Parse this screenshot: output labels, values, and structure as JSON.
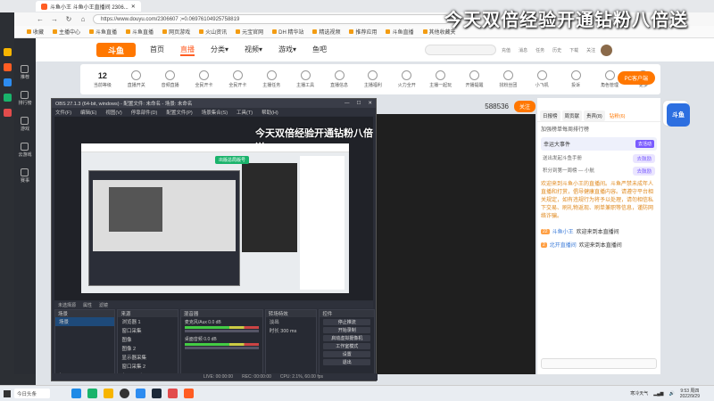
{
  "browser": {
    "tab_title": "斗鱼小王 斗鱼小王直播间 2306...",
    "url": "https://www.douyu.com/2306607 ;=0.06976104925758819",
    "bookmarks": [
      "收藏",
      "主播中心",
      "斗鱼直播",
      "斗鱼直播",
      "网页游戏",
      "火山资讯",
      "元宝官网",
      "DH 精华站",
      "精选视频",
      "推荐应用",
      "斗鱼直播",
      "其他收藏夹"
    ]
  },
  "overlay_title": "今天双倍经验开通钻粉八倍送",
  "site": {
    "logo": "斗鱼",
    "nav": [
      "首页",
      "直播",
      "分类▾",
      "视频▾",
      "游戏▾",
      "鱼吧"
    ],
    "active_nav": "直播",
    "header_icons": [
      "充值",
      "消息",
      "任务",
      "历史",
      "下载",
      "关注"
    ],
    "sidebar": [
      "推荐",
      "排行榜",
      "游戏",
      "云游戏",
      "赛事"
    ],
    "categories": [
      {
        "label": "当前等级",
        "value": "12"
      },
      {
        "label": "直播开关"
      },
      {
        "label": "音频直播"
      },
      {
        "label": "全民开卡"
      },
      {
        "label": "全民开卡"
      },
      {
        "label": "主播任务"
      },
      {
        "label": "主播工具"
      },
      {
        "label": "直播信息"
      },
      {
        "label": "主播福利"
      },
      {
        "label": "火力全开"
      },
      {
        "label": "主播一起玩"
      },
      {
        "label": "开播提醒"
      },
      {
        "label": "找粉丝团"
      },
      {
        "label": "小飞机"
      },
      {
        "label": "投诉"
      },
      {
        "label": "角色管理"
      },
      {
        "label": "更多"
      }
    ],
    "pc_button": "PC客户端"
  },
  "room": {
    "room_id": "588536",
    "follow_label": "关注"
  },
  "chat": {
    "tabs": [
      "日报榜",
      "周贡献",
      "贵宾(8)",
      "钻粉(6)"
    ],
    "active_tab": "钻粉(6)",
    "head": "加强榜单每周排行榜",
    "rank_title": "幸运大事件",
    "rank_tag": "去活动",
    "gifts": [
      {
        "name": "送出发起斗鱼手册",
        "action": "去鼓励"
      },
      {
        "name": "积分到第一周榜 — 小航",
        "action": "去鼓励"
      }
    ],
    "notice": "欢迎来到斗鱼小王的直播间。斗鱼严禁未成年人直播和打赏，倡导健康直播内容。请遵守平台相关规定，如有违规行为将予以处理，请勿相信私下交易、刷礼物返现、刷单兼职等信息，谨防网络诈骗。",
    "messages": [
      {
        "level": "22",
        "user": "斗鱼小王",
        "text": "欢迎来到本直播间"
      },
      {
        "level": "2",
        "user": "北开直播间",
        "text": "欢迎来到本直播间"
      }
    ]
  },
  "obs": {
    "title": "OBS 27.1.3 (64-bit, windows) - 配置文件: 未命名 - 场景: 未命名",
    "menu": [
      "文件(F)",
      "编辑(E)",
      "视图(V)",
      "停靠部件(D)",
      "配置文件(P)",
      "场景集合(S)",
      "工具(T)",
      "帮助(H)"
    ],
    "overlay_text": "今天双倍经验开通钻粉八倍送",
    "nested_badge": "出版总局版号",
    "scene_bar": [
      "未选择源",
      "属性",
      "滤镜"
    ],
    "docks": {
      "scenes": {
        "title": "场景",
        "items": [
          "场景"
        ]
      },
      "sources": {
        "title": "来源",
        "items": [
          "浏览器 1",
          "窗口采集",
          "图像",
          "图像 2",
          "显示器采集",
          "窗口采集 2"
        ]
      },
      "mixer": {
        "title": "混音器",
        "rows": [
          {
            "name": "麦克风/Aux",
            "db": "0.0 dB"
          },
          {
            "name": "桌面音频",
            "db": "0.0 dB"
          }
        ]
      },
      "transitions": {
        "title": "转场特效",
        "mode": "淡出",
        "duration_label": "时长",
        "duration": "300 ms"
      },
      "controls": {
        "title": "控件",
        "buttons": [
          "停止推流",
          "开始录制",
          "启动虚拟摄像机",
          "工作室模式",
          "设置",
          "退出"
        ]
      }
    },
    "status": [
      "LIVE: 00:00:00",
      "REC: 00:00:00",
      "CPU: 2.1%, 60.00 fps"
    ]
  },
  "taskbar": {
    "search": "今日头条",
    "time": "9:53 周四",
    "date": "2022/9/29",
    "tray_text": "寒冷天气"
  },
  "colors": {
    "accent": "#ff7700",
    "obs_bg": "#2b2e38",
    "chat_purple": "#7a5cff"
  }
}
